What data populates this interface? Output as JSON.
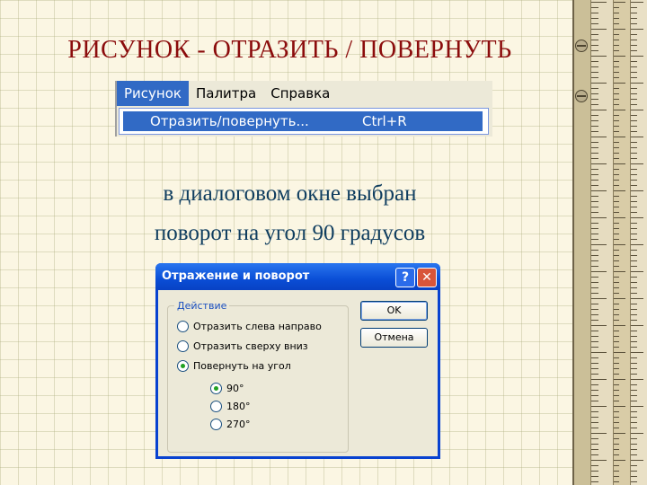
{
  "slide": {
    "title": "РИСУНОК  -  ОТРАЗИТЬ / ПОВЕРНУТЬ",
    "line1": "в диалоговом окне выбран",
    "line2": "поворот на угол 90 градусов"
  },
  "menu": {
    "items": [
      "Рисунок",
      "Палитра",
      "Справка"
    ],
    "dropdown_item": "Отразить/повернуть...",
    "shortcut": "Ctrl+R"
  },
  "dialog": {
    "title": "Отражение и поворот",
    "help": "?",
    "close": "✕",
    "group_label": "Действие",
    "options": [
      {
        "label": "Отразить слева направо",
        "checked": false
      },
      {
        "label": "Отразить сверху вниз",
        "checked": false
      },
      {
        "label": "Повернуть на угол",
        "checked": true
      }
    ],
    "angles": [
      {
        "label": "90°",
        "checked": true
      },
      {
        "label": "180°",
        "checked": false
      },
      {
        "label": "270°",
        "checked": false
      }
    ],
    "ok": "OK",
    "cancel": "Отмена"
  },
  "colors": {
    "title": "#8b0c0c",
    "body_text": "#0f3d5f",
    "selection": "#316ac5"
  }
}
